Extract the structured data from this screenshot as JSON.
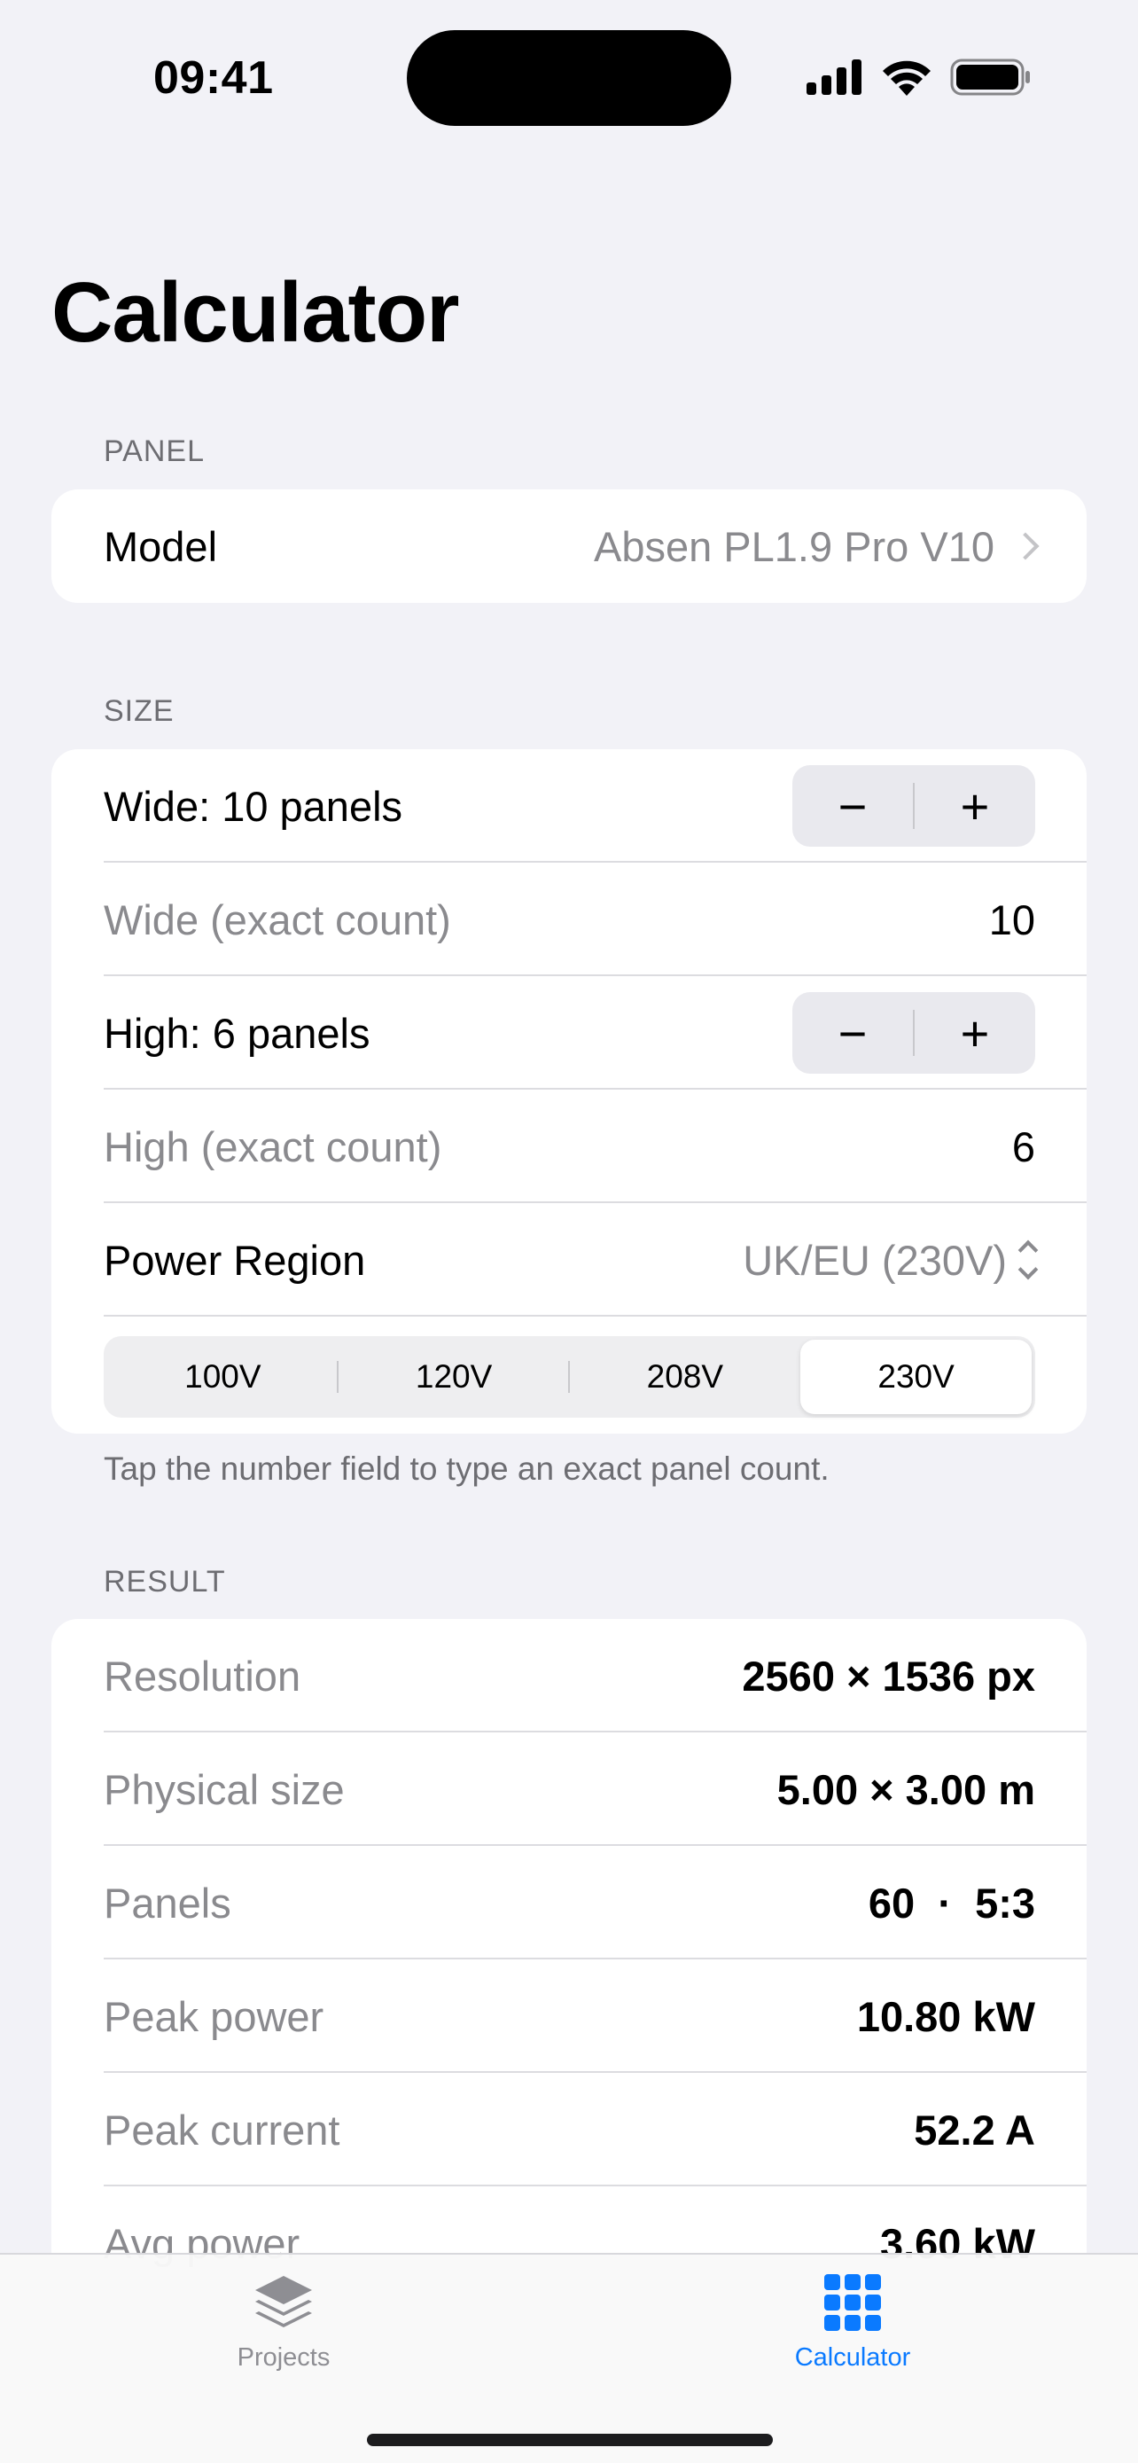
{
  "status_bar": {
    "time": "09:41"
  },
  "title": "Calculator",
  "panel_section": {
    "header": "PANEL",
    "model_label": "Model",
    "model_value": "Absen PL1.9 Pro V10"
  },
  "size_section": {
    "header": "SIZE",
    "wide_label": "Wide: 10 panels",
    "wide_exact_label": "Wide (exact count)",
    "wide_exact_value": "10",
    "high_label": "High: 6 panels",
    "high_exact_label": "High (exact count)",
    "high_exact_value": "6",
    "power_region_label": "Power Region",
    "power_region_value": "UK/EU (230V)",
    "stepper_minus": "−",
    "stepper_plus": "+",
    "voltages": [
      "100V",
      "120V",
      "208V",
      "230V"
    ],
    "selected_voltage": "230V",
    "footnote": "Tap the number field to type an exact panel count."
  },
  "result_section": {
    "header": "RESULT",
    "rows": [
      {
        "label": "Resolution",
        "value": "2560 × 1536 px"
      },
      {
        "label": "Physical size",
        "value": "5.00 × 3.00 m"
      },
      {
        "label": "Panels",
        "value": "60  ·  5:3"
      },
      {
        "label": "Peak power",
        "value": "10.80 kW"
      },
      {
        "label": "Peak current",
        "value": "52.2 A"
      },
      {
        "label": "Avg power",
        "value": "3.60 kW"
      }
    ]
  },
  "tab_bar": {
    "tabs": [
      {
        "label": "Projects",
        "icon": "stack-icon",
        "selected": false
      },
      {
        "label": "Calculator",
        "icon": "grid-icon",
        "selected": true
      }
    ],
    "accent_color": "#0a7aff",
    "inactive_color": "#8e8e93"
  }
}
